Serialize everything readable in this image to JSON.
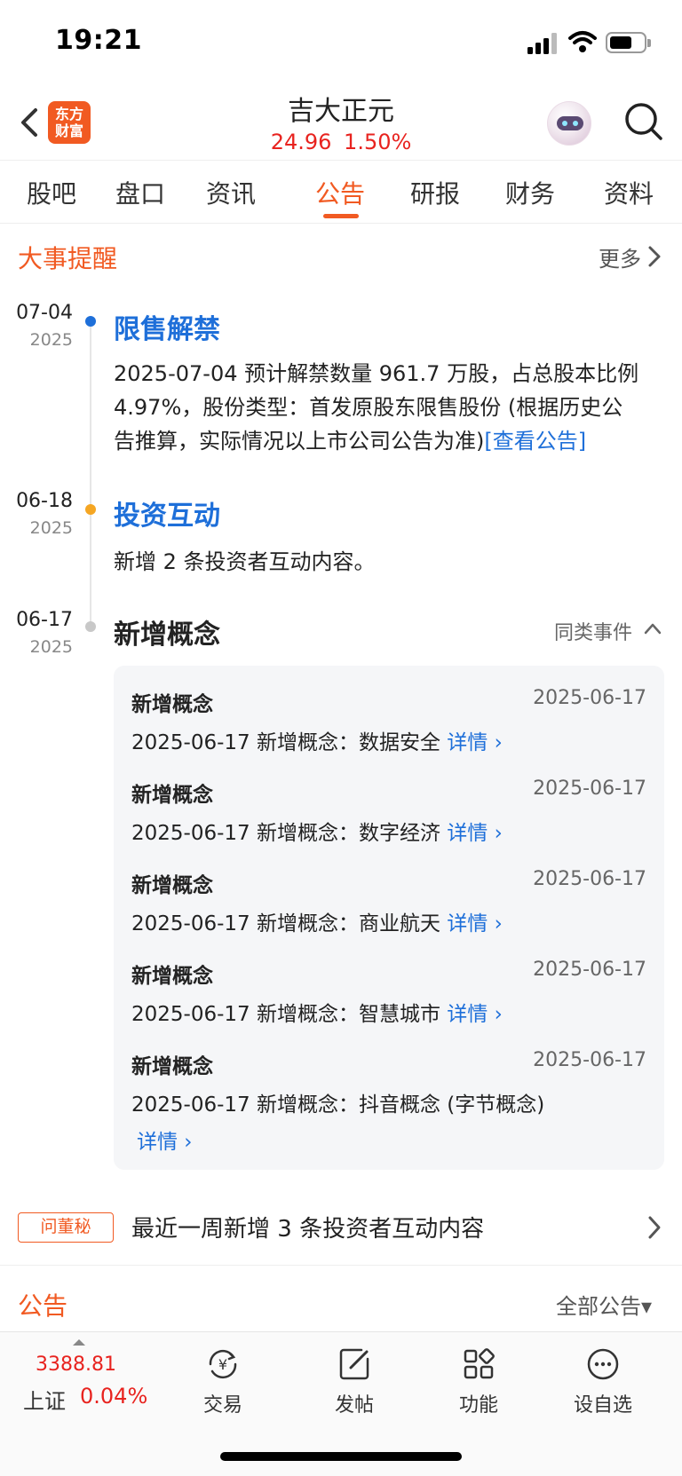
{
  "status_bar": {
    "time": "19:21"
  },
  "header": {
    "logo_line1": "东方",
    "logo_line2": "财富",
    "stock_name": "吉大正元",
    "price": "24.96",
    "change_pct": "1.50%"
  },
  "tabs": [
    "股吧",
    "盘口",
    "资讯",
    "公告",
    "研报",
    "财务",
    "资料"
  ],
  "events_section": {
    "title": "大事提醒",
    "more": "更多"
  },
  "timeline": [
    {
      "date": "07-04",
      "year": "2025",
      "title": "限售解禁",
      "body_line1": "2025-07-04 预计解禁数量 961.7 万股，占总股本比例",
      "body_line2": "4.97%，股份类型：首发原股东限售股份 (根据历史公",
      "body_line3": "告推算，实际情况以上市公司公告为准)",
      "link": "[查看公告]"
    },
    {
      "date": "06-18",
      "year": "2025",
      "title": "投资互动",
      "body": "新增 2 条投资者互动内容。"
    },
    {
      "date": "06-17",
      "year": "2025",
      "title": "新增概念",
      "same_events": "同类事件"
    }
  ],
  "concepts": [
    {
      "title": "新增概念",
      "date": "2025-06-17",
      "text": "2025-06-17 新增概念：数据安全",
      "detail": "详情"
    },
    {
      "title": "新增概念",
      "date": "2025-06-17",
      "text": "2025-06-17 新增概念：数字经济",
      "detail": "详情"
    },
    {
      "title": "新增概念",
      "date": "2025-06-17",
      "text": "2025-06-17 新增概念：商业航天",
      "detail": "详情"
    },
    {
      "title": "新增概念",
      "date": "2025-06-17",
      "text": "2025-06-17 新增概念：智慧城市",
      "detail": "详情"
    },
    {
      "title": "新增概念",
      "date": "2025-06-17",
      "text": "2025-06-17 新增概念：抖音概念 (字节概念)",
      "detail": "详情"
    }
  ],
  "secretary": {
    "badge": "问董秘",
    "text": "最近一周新增 3 条投资者互动内容"
  },
  "notice_section": {
    "title": "公告",
    "all": "全部公告▾"
  },
  "bottom_bar": {
    "index_value": "3388.81",
    "index_name": "上证",
    "index_change": "0.04%",
    "items": [
      "交易",
      "发帖",
      "功能",
      "设自选"
    ]
  },
  "colors": {
    "accent": "#f15a22",
    "up_red": "#e8231f",
    "link_blue": "#1e6fd9",
    "dot_blue": "#1e6fd9",
    "dot_orange": "#f5a623",
    "dot_gray": "#c8c8c8"
  }
}
